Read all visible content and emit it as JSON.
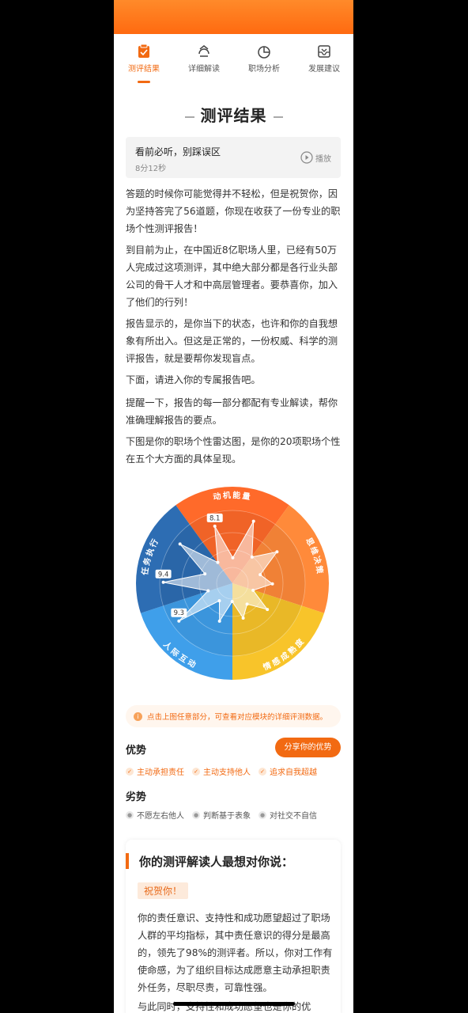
{
  "tabs": [
    {
      "label": "测评结果",
      "icon": "clipboard-icon",
      "active": true
    },
    {
      "label": "详细解读",
      "icon": "recycle-icon",
      "active": false
    },
    {
      "label": "职场分析",
      "icon": "pie-chart-icon",
      "active": false
    },
    {
      "label": "发展建议",
      "icon": "inbox-icon",
      "active": false
    }
  ],
  "page_title": "测评结果",
  "audio": {
    "title": "看前必听，别踩误区",
    "duration": "8分12秒",
    "play_label": "播放"
  },
  "paragraphs": [
    "答题的时候你可能觉得并不轻松，但是祝贺你，因为坚持答完了56道题，你现在收获了一份专业的职场个性测评报告！",
    "到目前为止，在中国近8亿职场人里，已经有50万人完成过这项测评，其中绝大部分都是各行业头部公司的骨干人才和中高层管理者。要恭喜你，加入了他们的行列！",
    "报告显示的，是你当下的状态，也许和你的自我想象有所出入。但这是正常的，一份权威、科学的测评报告，就是要帮你发现盲点。",
    "下面，请进入你的专属报告吧。",
    "提醒一下，报告的每一部分都配有专业解读，帮你准确理解报告的要点。",
    "下图是你的职场个性雷达图，是你的20项职场个性在五个大方面的具体呈现。"
  ],
  "chart_data": {
    "type": "radar",
    "sectors": [
      {
        "name": "动机能量",
        "color": "#ff6a2a"
      },
      {
        "name": "思维决策",
        "color": "#ff8a3a"
      },
      {
        "name": "情感成熟度",
        "color": "#f8c42a"
      },
      {
        "name": "人际互动",
        "color": "#3f9fea"
      },
      {
        "name": "任务执行",
        "color": "#2d6db3"
      }
    ],
    "value_labels": [
      "8.1",
      "9.4",
      "9.3"
    ]
  },
  "tip": "点击上图任意部分，可查看对应模块的详细评测数据。",
  "strengths": {
    "title": "优势",
    "share_label": "分享你的优势",
    "items": [
      "主动承担责任",
      "主动支持他人",
      "追求自我超越"
    ]
  },
  "weaknesses": {
    "title": "劣势",
    "items": [
      "不愿左右他人",
      "判断基于表象",
      "对社交不自信"
    ]
  },
  "card": {
    "title": "你的测评解读人最想对你说：",
    "tag": "祝贺你！",
    "body": "你的责任意识、支持性和成功愿望超过了职场人群的平均指标，其中责任意识的得分是最高的，领先了98%的测评者。所以，你对工作有使命感，为了组织目标达成愿意主动承担职责外任务，尽职尽责，可靠性强。",
    "body2": "与此同时，支持性和成功愿望也是你的优"
  }
}
